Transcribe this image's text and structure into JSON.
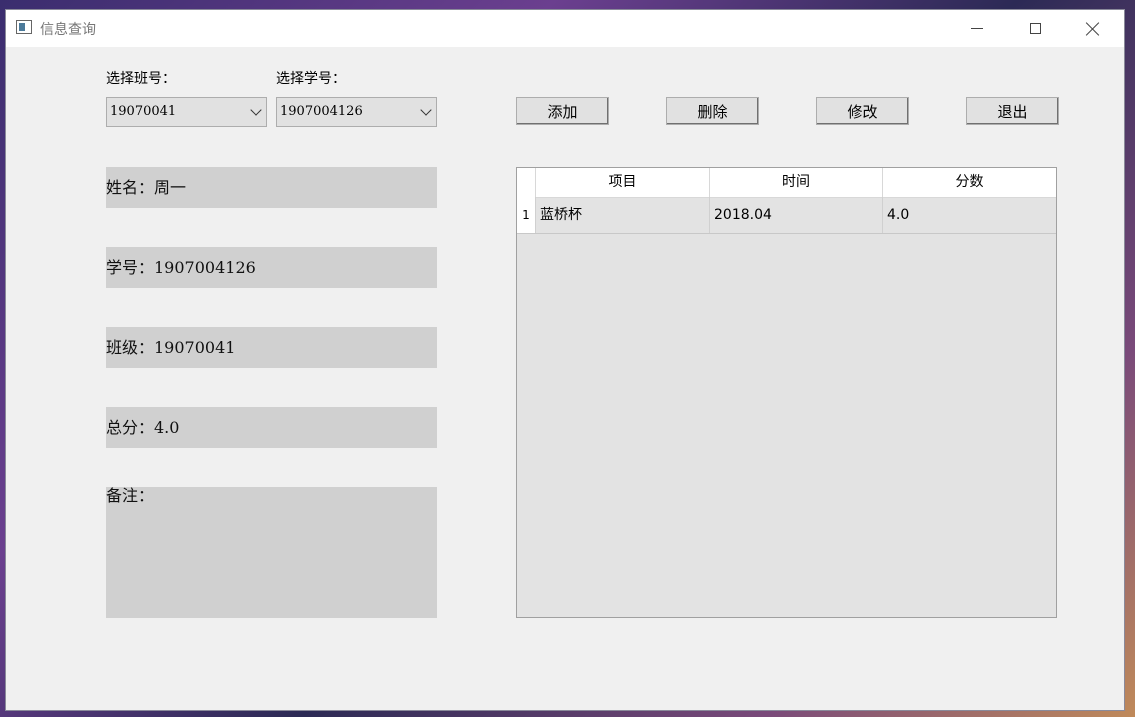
{
  "window": {
    "title": "信息查询"
  },
  "selectors": {
    "class_label": "选择班号：",
    "class_value": "19070041",
    "student_label": "选择学号：",
    "student_value": "1907004126"
  },
  "buttons": {
    "add": "添加",
    "delete": "删除",
    "edit": "修改",
    "exit": "退出"
  },
  "info": {
    "name": "姓名：周一",
    "id": "学号：1907004126",
    "class": "班级：19070041",
    "total": "总分：4.0",
    "remark": "备注："
  },
  "table": {
    "headers": [
      "项目",
      "时间",
      "分数"
    ],
    "rows": [
      {
        "num": "1",
        "item": "蓝桥杯",
        "time": "2018.04",
        "score": "4.0"
      }
    ]
  }
}
